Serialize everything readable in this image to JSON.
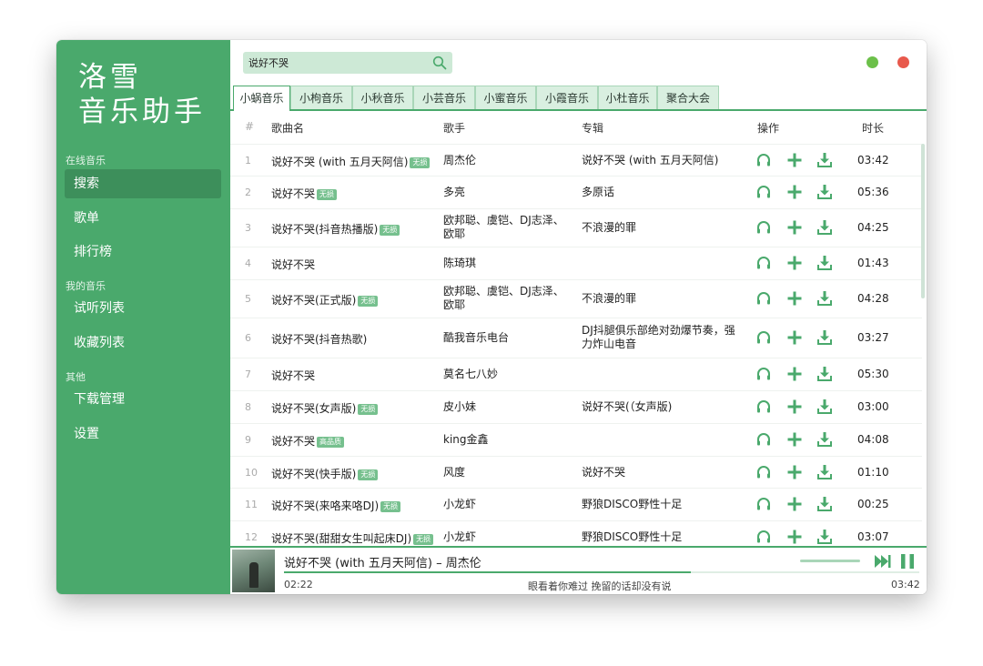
{
  "app": {
    "logo_line1": "洛雪",
    "logo_line2": "音乐助手"
  },
  "sidebar": {
    "sections": [
      {
        "label": "在线音乐",
        "items": [
          {
            "label": "搜索",
            "active": true
          },
          {
            "label": "歌单"
          },
          {
            "label": "排行榜"
          }
        ]
      },
      {
        "label": "我的音乐",
        "items": [
          {
            "label": "试听列表"
          },
          {
            "label": "收藏列表"
          }
        ]
      },
      {
        "label": "其他",
        "items": [
          {
            "label": "下载管理"
          },
          {
            "label": "设置"
          }
        ]
      }
    ]
  },
  "search": {
    "value": "说好不哭",
    "placeholder": ""
  },
  "tabs": [
    {
      "label": "小蜗音乐",
      "active": true
    },
    {
      "label": "小枸音乐"
    },
    {
      "label": "小秋音乐"
    },
    {
      "label": "小芸音乐"
    },
    {
      "label": "小蜜音乐"
    },
    {
      "label": "小霞音乐"
    },
    {
      "label": "小杜音乐"
    },
    {
      "label": "聚合大会"
    }
  ],
  "table": {
    "headers": {
      "index": "#",
      "song": "歌曲名",
      "singer": "歌手",
      "album": "专辑",
      "ops": "操作",
      "duration": "时长"
    },
    "rows": [
      {
        "index": "1",
        "song": "说好不哭 (with 五月天阿信)",
        "badge": "无损",
        "singer": "周杰伦",
        "album": "说好不哭 (with 五月天阿信)",
        "duration": "03:42"
      },
      {
        "index": "2",
        "song": "说好不哭",
        "badge": "无损",
        "singer": "多亮",
        "album": "多原话",
        "duration": "05:36"
      },
      {
        "index": "3",
        "song": "说好不哭(抖音热播版)",
        "badge": "无损",
        "singer": "欧邦聪、虞铠、DJ志泽、欧耶",
        "album": "不浪漫的罪",
        "duration": "04:25"
      },
      {
        "index": "4",
        "song": "说好不哭",
        "badge": "",
        "singer": "陈琦琪",
        "album": "",
        "duration": "01:43"
      },
      {
        "index": "5",
        "song": "说好不哭(正式版)",
        "badge": "无损",
        "singer": "欧邦聪、虞铠、DJ志泽、欧耶",
        "album": "不浪漫的罪",
        "duration": "04:28"
      },
      {
        "index": "6",
        "song": "说好不哭(抖音热歌)",
        "badge": "",
        "singer": "酷我音乐电台",
        "album": "DJ抖腿俱乐部绝对劲爆节奏，强力炸山电音",
        "duration": "03:27"
      },
      {
        "index": "7",
        "song": "说好不哭",
        "badge": "",
        "singer": "莫名七八妙",
        "album": "",
        "duration": "05:30"
      },
      {
        "index": "8",
        "song": "说好不哭(女声版)",
        "badge": "无损",
        "singer": "皮小妹",
        "album": "说好不哭(（女声版)",
        "duration": "03:00"
      },
      {
        "index": "9",
        "song": "说好不哭",
        "badge": "高品质",
        "singer": "king金鑫",
        "album": "",
        "duration": "04:08"
      },
      {
        "index": "10",
        "song": "说好不哭(快手版)",
        "badge": "无损",
        "singer": "风度",
        "album": "说好不哭",
        "duration": "01:10"
      },
      {
        "index": "11",
        "song": "说好不哭(来咯来咯DJ)",
        "badge": "无损",
        "singer": "小龙虾",
        "album": "野狼DISCO野性十足",
        "duration": "00:25"
      },
      {
        "index": "12",
        "song": "说好不哭(甜甜女生叫起床DJ)",
        "badge": "无损",
        "singer": "小龙虾",
        "album": "野狼DISCO野性十足",
        "duration": "03:07"
      }
    ]
  },
  "player": {
    "title": "说好不哭 (with 五月天阿信) – 周杰伦",
    "current_time": "02:22",
    "lyric": "眼看着你难过 挽留的话却没有说",
    "total_time": "03:42",
    "progress": 0.64
  },
  "icons": {
    "search": "search-icon",
    "listen": "headphones-icon",
    "add": "plus-icon",
    "download": "download-icon",
    "next": "next-icon",
    "pause": "pause-icon"
  },
  "colors": {
    "accent": "#4aa96c",
    "accent_dark": "#3d8f5b",
    "tab_bg": "#d9efe0",
    "badge": "#76c08e",
    "dot_green": "#6cc04a",
    "dot_red": "#e8594c"
  }
}
